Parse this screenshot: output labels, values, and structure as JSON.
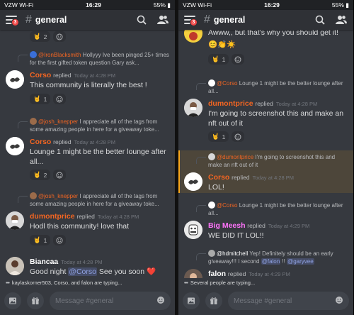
{
  "left": {
    "status": {
      "carrier": "VZW Wi-Fi",
      "time": "16:29",
      "battery": "55%"
    },
    "header": {
      "badge": "3",
      "channel": "general"
    },
    "messages": [
      {
        "reactions": [
          {
            "emoji": "🤘",
            "count": "2"
          }
        ]
      },
      {
        "reply_to": {
          "name": "@IronBlacksmith",
          "text": "Hollyyy Ive been pinged 25+ times for the first gifted token question Gary ask..."
        },
        "user": "Corso",
        "user_color": "#f26522",
        "replied": "replied",
        "time": "Today at 4:28 PM",
        "text": "This community is literally the best !",
        "reactions": [
          {
            "emoji": "🤘",
            "count": "1"
          }
        ]
      },
      {
        "reply_to": {
          "name": "@josh_knepper",
          "text": "I appreciate all of the tags from some amazing people in here for a giveaway toke..."
        },
        "user": "Corso",
        "user_color": "#f26522",
        "replied": "replied",
        "time": "Today at 4:28 PM",
        "text": "Lounge 1 might be the better lounge after all...",
        "reactions": [
          {
            "emoji": "🤘",
            "count": "2"
          }
        ]
      },
      {
        "reply_to": {
          "name": "@josh_knepper",
          "text": "I appreciate all of the tags from some amazing people in here for a giveaway toke..."
        },
        "user": "dumontprice",
        "user_color": "#f26522",
        "replied": "replied",
        "time": "Today at 4:28 PM",
        "text": "Hodl this community! love that",
        "reactions": [
          {
            "emoji": "🤘",
            "count": "1"
          }
        ]
      },
      {
        "user": "Biancaa",
        "user_color": "#ffffff",
        "time": "Today at 4:28 PM",
        "text_parts": [
          "Good night ",
          "@Corso",
          " See you soon ",
          "❤️"
        ]
      }
    ],
    "typing": "kaylaskorner503, Corso, and falon are typing...",
    "composer": {
      "placeholder": "Message #general"
    }
  },
  "right": {
    "status": {
      "carrier": "VZW Wi-Fi",
      "time": "16:29",
      "battery": "55%"
    },
    "header": {
      "badge": "3",
      "channel": "general"
    },
    "messages": [
      {
        "text": "Awww,, but that's why you should get it!",
        "emoji_line": "😊👏☀️",
        "reactions": [
          {
            "emoji": "🤘",
            "count": "1"
          }
        ]
      },
      {
        "reply_to": {
          "name": "@Corso",
          "text": "Lounge 1 might be the better lounge after all..."
        },
        "user": "dumontprice",
        "user_color": "#f26522",
        "replied": "replied",
        "time": "Today at 4:28 PM",
        "text": "I'm going to screenshot this and make an nft out of it",
        "reactions": [
          {
            "emoji": "🤘",
            "count": "1"
          }
        ]
      },
      {
        "reply_to": {
          "name": "@dumontprice",
          "text": "I'm going to screenshot this and make an nft out of it"
        },
        "user": "Corso",
        "user_color": "#f26522",
        "replied": "replied",
        "time": "Today at 4:28 PM",
        "text": "LOL!"
      },
      {
        "reply_to": {
          "name": "@Corso",
          "text": "Lounge 1 might be the better lounge after all..."
        },
        "user": "Big Meesh",
        "user_color": "#ff73fa",
        "replied": "replied",
        "time": "Today at 4:29 PM",
        "text": "WE DID IT LOL!!"
      },
      {
        "reply_to": {
          "name": "@hdmitchell",
          "text": "Yep! Definitely should be an early giveaway!!! I second ",
          "mention1": "@falon",
          "mid": " !! ",
          "mention2": "@garyvee"
        },
        "user": "falon",
        "user_color": "#ffffff",
        "replied": "replied",
        "time": "Today at 4:29 PM"
      }
    ],
    "typing": "Several people are typing...",
    "composer": {
      "placeholder": "Message #general"
    }
  }
}
